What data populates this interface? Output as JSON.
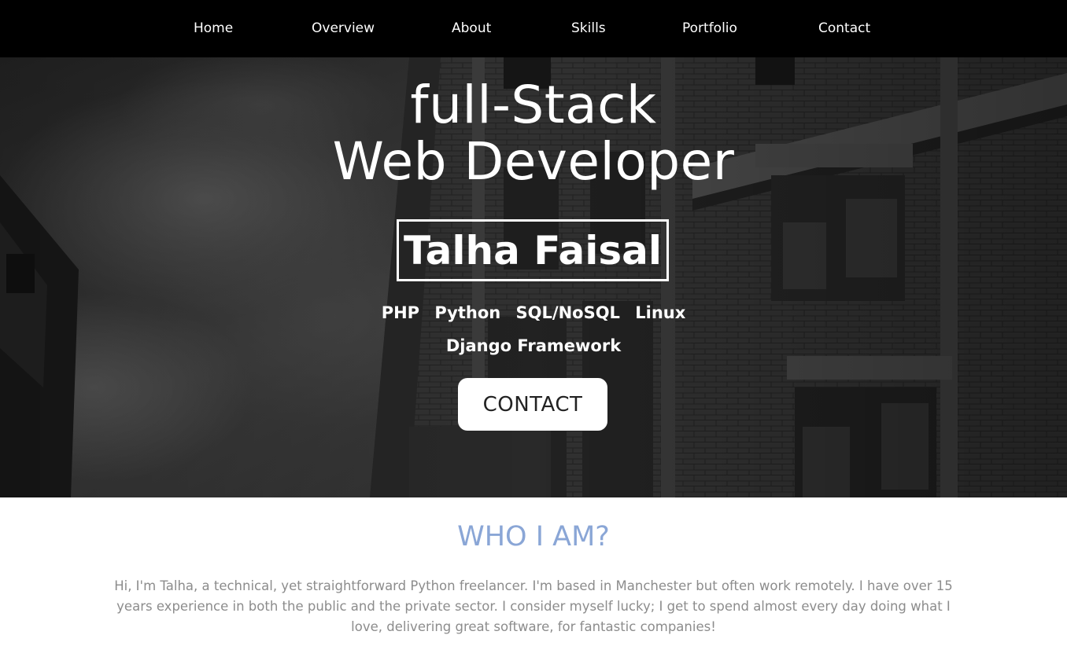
{
  "nav": {
    "items": [
      {
        "label": "Home"
      },
      {
        "label": "Overview"
      },
      {
        "label": "About"
      },
      {
        "label": "Skills"
      },
      {
        "label": "Portfolio"
      },
      {
        "label": "Contact"
      }
    ]
  },
  "hero": {
    "title_line1": "full-Stack",
    "title_line2": "Web Developer",
    "name": "Talha Faisal",
    "skills": [
      "PHP",
      "Python",
      "SQL/NoSQL",
      "Linux",
      "Django Framework"
    ],
    "cta_label": "CONTACT"
  },
  "about": {
    "heading": "WHO I AM?",
    "body": "Hi, I'm Talha, a technical, yet straightforward Python freelancer. I'm based in Manchester but often work remotely. I have over 15 years experience in both the public and the private sector. I consider myself lucky; I get to spend almost every day doing what I love, delivering great software, for fantastic companies!"
  },
  "colors": {
    "navbar_bg": "#000000",
    "accent_heading": "#8aa6d6",
    "body_text": "#8c8c8c",
    "hero_overlay": "#2b2b2b"
  }
}
